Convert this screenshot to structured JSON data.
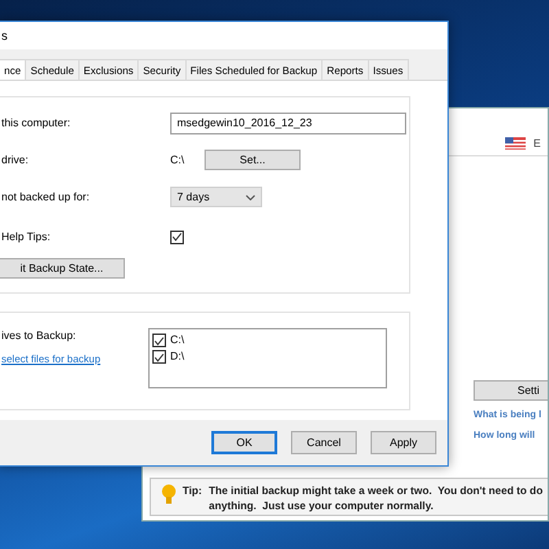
{
  "front_window": {
    "title": "s",
    "tabs": [
      {
        "label": "nce",
        "selected": true
      },
      {
        "label": "Schedule",
        "selected": false
      },
      {
        "label": "Exclusions",
        "selected": false
      },
      {
        "label": "Security",
        "selected": false
      },
      {
        "label": "Files Scheduled for Backup",
        "selected": false
      },
      {
        "label": "Reports",
        "selected": false
      },
      {
        "label": "Issues",
        "selected": false
      }
    ],
    "settings": {
      "computer_name": {
        "label": "this computer:",
        "value": "msedgewin10_2016_12_23"
      },
      "drive": {
        "label": "drive:",
        "value": "C:\\",
        "button": "Set..."
      },
      "warn_after": {
        "label": "not backed up for:",
        "value": "7 days"
      },
      "help_tips": {
        "label": "Help Tips:",
        "checked": true
      },
      "reset_button": "it Backup State..."
    },
    "drives": {
      "label": "ives to Backup:",
      "link": "select files for backup",
      "items": [
        {
          "label": "C:\\",
          "checked": true
        },
        {
          "label": "D:\\",
          "checked": true
        }
      ]
    },
    "buttons": [
      {
        "label": "OK",
        "focused": true
      },
      {
        "label": "Cancel",
        "focused": false
      },
      {
        "label": "Apply",
        "focused": false
      }
    ]
  },
  "back_window": {
    "language": "E",
    "settings_button": "Setti",
    "links": [
      "What is being l",
      "How long will"
    ],
    "tip": {
      "label": "Tip:",
      "text": "The initial backup might take a week or two.  You don't need to do anything.  Just use your computer normally."
    }
  }
}
